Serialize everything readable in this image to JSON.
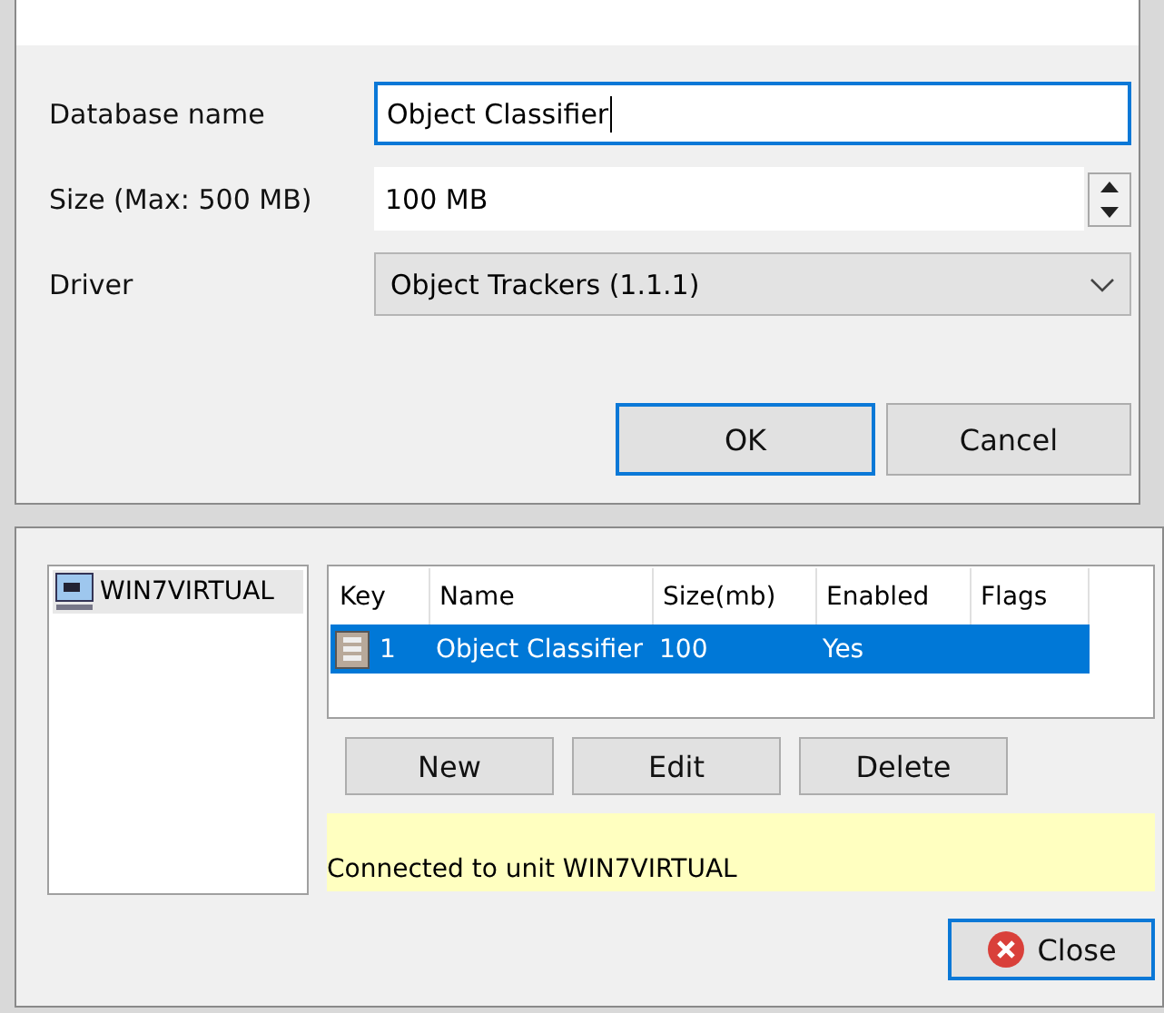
{
  "edit_dialog": {
    "fields": [
      {
        "label": "Database name",
        "kind": "text",
        "value": "Object Classifier",
        "focused": true
      },
      {
        "label": "Size (Max: 500 MB)",
        "kind": "spin",
        "value": "100 MB",
        "focused": false
      },
      {
        "label": "Driver",
        "kind": "select",
        "value": "Object Trackers (1.1.1)",
        "focused": false
      }
    ],
    "buttons": [
      {
        "label": "OK",
        "default": true
      },
      {
        "label": "Cancel",
        "default": false
      }
    ]
  },
  "manager": {
    "tree": [
      {
        "label": "WIN7VIRTUAL",
        "selected": true
      }
    ],
    "table": {
      "columns": [
        "Key",
        "Name",
        "Size(mb)",
        "Enabled",
        "Flags"
      ],
      "rows": [
        {
          "cells": [
            "1",
            "Object Classifier",
            "100",
            "Yes",
            ""
          ],
          "selected": true
        }
      ]
    },
    "buttons": [
      "New",
      "Edit",
      "Delete"
    ],
    "status": "Connected to unit WIN7VIRTUAL",
    "close_button": "Close"
  }
}
